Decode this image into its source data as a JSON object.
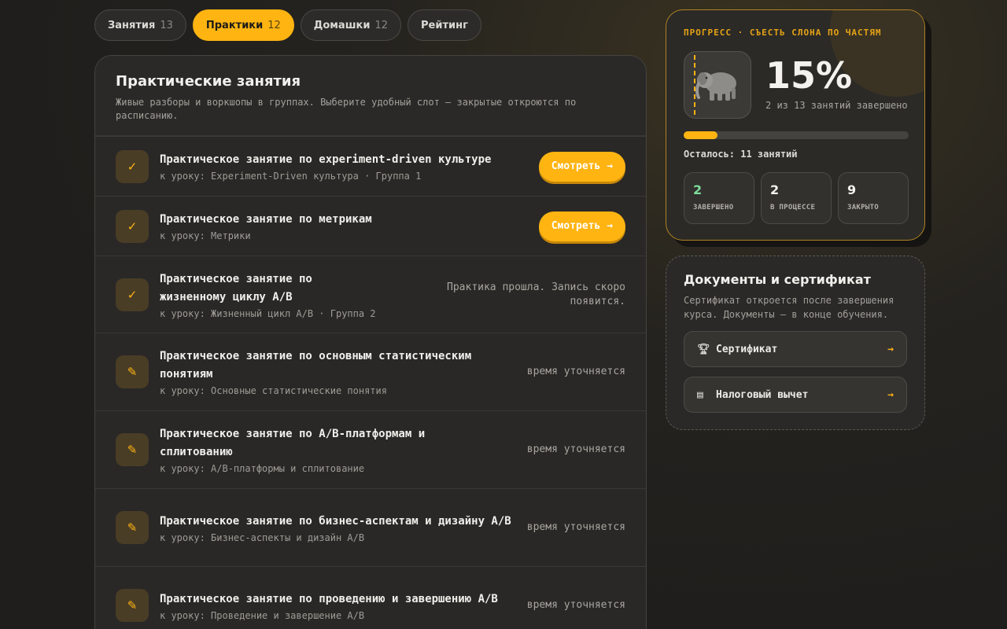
{
  "tabs": [
    {
      "label": "Занятия",
      "count": "13"
    },
    {
      "label": "Практики",
      "count": "12"
    },
    {
      "label": "Домашки",
      "count": "12"
    },
    {
      "label": "Рейтинг",
      "count": ""
    }
  ],
  "active_tab": "Практики",
  "main": {
    "title": "Практические занятия",
    "subtitle": "Живые разборы и воркшопы в группах. Выберите удобный слот — закрытые откроются по расписанию.",
    "rows": [
      {
        "icon": "check-icon",
        "title": "Практическое занятие по experiment-driven культуре",
        "sub": "к уроку: Experiment-Driven культура · Группа 1",
        "action": "Смотреть →"
      },
      {
        "icon": "check-icon",
        "title": "Практическое занятие по метрикам",
        "sub": "к уроку: Метрики",
        "action": "Смотреть →"
      },
      {
        "icon": "check-icon",
        "title": "Практическое занятие по жизненному циклу A/B",
        "sub": "к уроку: Жизненный цикл A/B · Группа 2",
        "status": "Практика прошла. Запись скоро появится."
      },
      {
        "icon": "pencil-icon",
        "title": "Практическое занятие по основным статистическим понятиям",
        "sub": "к уроку: Основные статистические понятия",
        "status": "время уточняется"
      },
      {
        "icon": "pencil-icon",
        "title": "Практическое занятие по A/B-платформам и сплитованию",
        "sub": "к уроку: A/B-платформы и сплитование",
        "status": "время уточняется"
      },
      {
        "icon": "pencil-icon",
        "title": "Практическое занятие по бизнес-аспектам и дизайну A/B",
        "sub": "к уроку: Бизнес-аспекты и дизайн A/B",
        "status": "время уточняется"
      },
      {
        "icon": "pencil-icon",
        "title": "Практическое занятие по проведению и завершению A/B",
        "sub": "к уроку: Проведение и завершение A/B",
        "status": "время уточняется"
      }
    ]
  },
  "progress": {
    "label": "ПРОГРЕСС · СЪЕСТЬ СЛОНА ПО ЧАСТЯМ",
    "icon": "elephant-icon",
    "percent_text": "15%",
    "percent_value": 0.15,
    "summary": "2 из 13 занятий завершено",
    "remaining": "Осталось: 11 занятий",
    "stats": [
      {
        "value": "2",
        "label": "ЗАВЕРШЕНО",
        "color": "#7ddc9a"
      },
      {
        "value": "2",
        "label": "В ПРОЦЕССЕ",
        "color": "#f4f2ee"
      },
      {
        "value": "9",
        "label": "ЗАКРЫТО",
        "color": "#f4f2ee"
      }
    ],
    "accent": "#ffb412"
  },
  "docs": {
    "title": "Документы и сертификат",
    "subtitle": "Сертификат откроется после завершения курса. Документы — в конце обучения.",
    "items": [
      {
        "icon": "trophy-icon",
        "label": "Сертификат",
        "arrow": "→"
      },
      {
        "icon": "receipt-icon",
        "label": "Налоговый вычет",
        "arrow": "→"
      }
    ]
  }
}
